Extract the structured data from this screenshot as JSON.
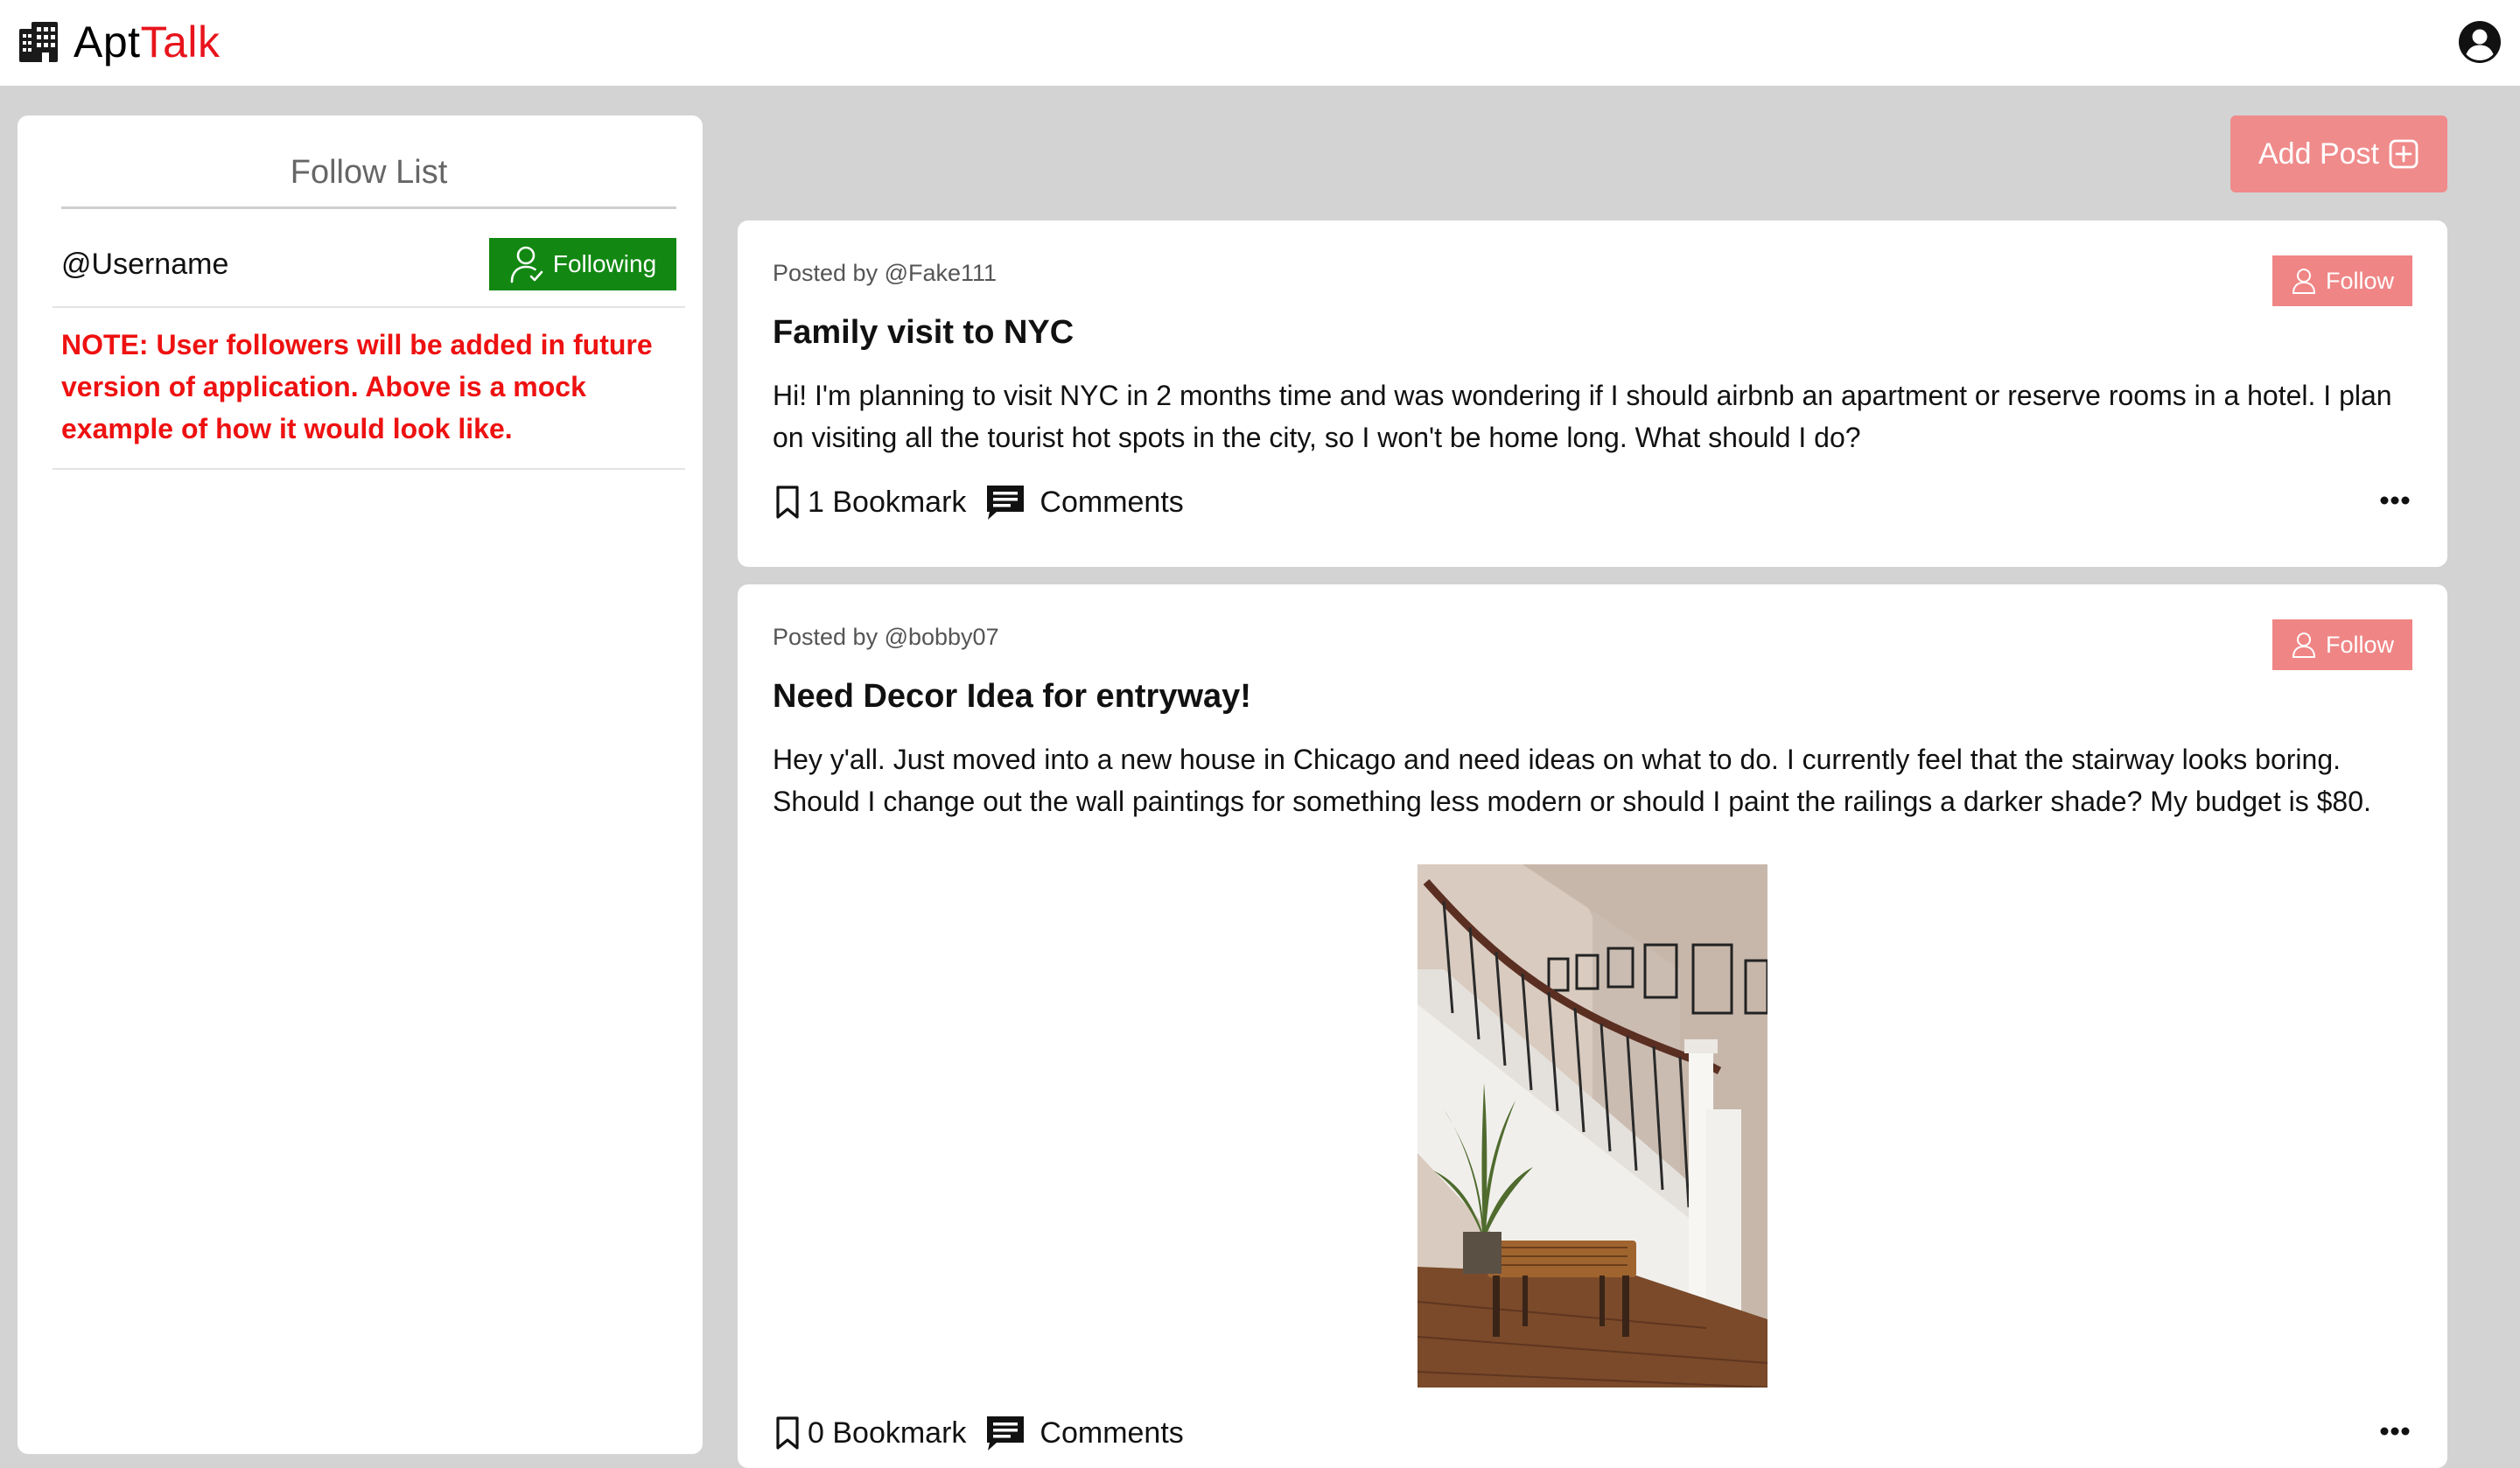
{
  "app": {
    "name_primary": "Apt",
    "name_accent": "Talk",
    "logo_icon": "building-icon",
    "account_icon": "user-circle-icon",
    "colors": {
      "accent": "#e8141c",
      "page_background": "#d3d3d3",
      "following": "#128812",
      "follow": "#f08585",
      "add_post": "#f08b8b",
      "note": "#ee1111"
    }
  },
  "sidebar": {
    "title": "Follow List",
    "follows": [
      {
        "username": "@Username",
        "button_label": "Following",
        "button_icon": "user-check-icon"
      }
    ],
    "note": "NOTE: User followers will be added in future version of application. Above is a mock example of how it would look like."
  },
  "toolbar": {
    "add_post_label": "Add Post",
    "add_post_icon": "plus-square-icon"
  },
  "posts": [
    {
      "author": "Posted by @Fake111",
      "follow_label": "Follow",
      "title": "Family visit to NYC",
      "body": "Hi! I'm planning to visit NYC in 2 months time and was wondering if I should airbnb an apartment or reserve rooms in a hotel. I plan on visiting all the tourist hot spots in the city, so I won't be home long. What should I do?",
      "bookmark_label": "1 Bookmark",
      "comments_label": "Comments",
      "has_image": false
    },
    {
      "author": "Posted by @bobby07",
      "follow_label": "Follow",
      "title": "Need Decor Idea for entryway!",
      "body": "Hey y'all. Just moved into a new house in Chicago and need ideas on what to do. I currently feel that the stairway looks boring. Should I change out the wall paintings for something less modern or should I paint the railings a darker shade? My budget is $80.",
      "bookmark_label": "0 Bookmark",
      "comments_label": "Comments",
      "has_image": true
    }
  ]
}
